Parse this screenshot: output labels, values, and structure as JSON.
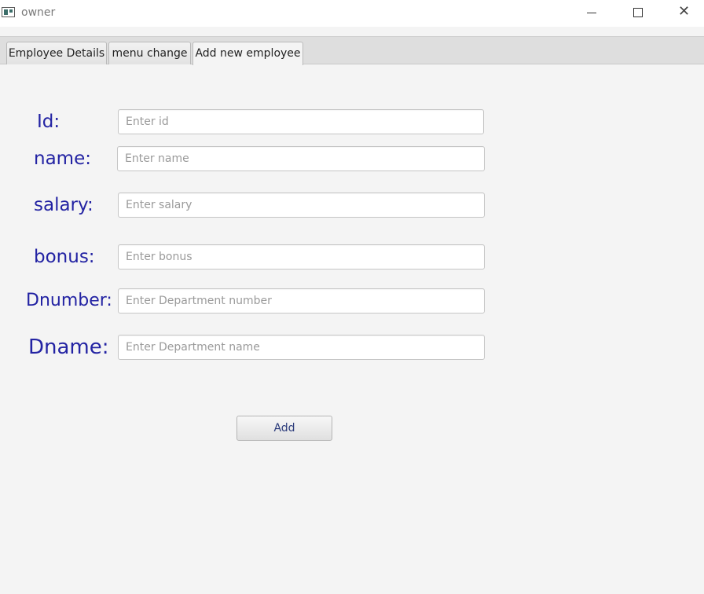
{
  "window": {
    "title": "owner",
    "controls": {
      "minimize": "minimize-icon",
      "maximize": "maximize-icon",
      "close": "close-icon"
    }
  },
  "tabs": [
    {
      "label": "Employee Details",
      "selected": false
    },
    {
      "label": "menu change",
      "selected": false
    },
    {
      "label": "Add new employee",
      "selected": true
    }
  ],
  "form": {
    "fields": [
      {
        "label": "Id:",
        "placeholder": "Enter id",
        "value": ""
      },
      {
        "label": "name:",
        "placeholder": "Enter name",
        "value": ""
      },
      {
        "label": "salary:",
        "placeholder": "Enter salary",
        "value": ""
      },
      {
        "label": "bonus:",
        "placeholder": "Enter bonus",
        "value": ""
      },
      {
        "label": "Dnumber:",
        "placeholder": "Enter Department number",
        "value": ""
      },
      {
        "label": "Dname:",
        "placeholder": "Enter Department name",
        "value": ""
      }
    ],
    "submit_label": "Add"
  },
  "colors": {
    "label": "#2323a3",
    "background": "#f4f4f4",
    "tabbar": "#dedede"
  }
}
